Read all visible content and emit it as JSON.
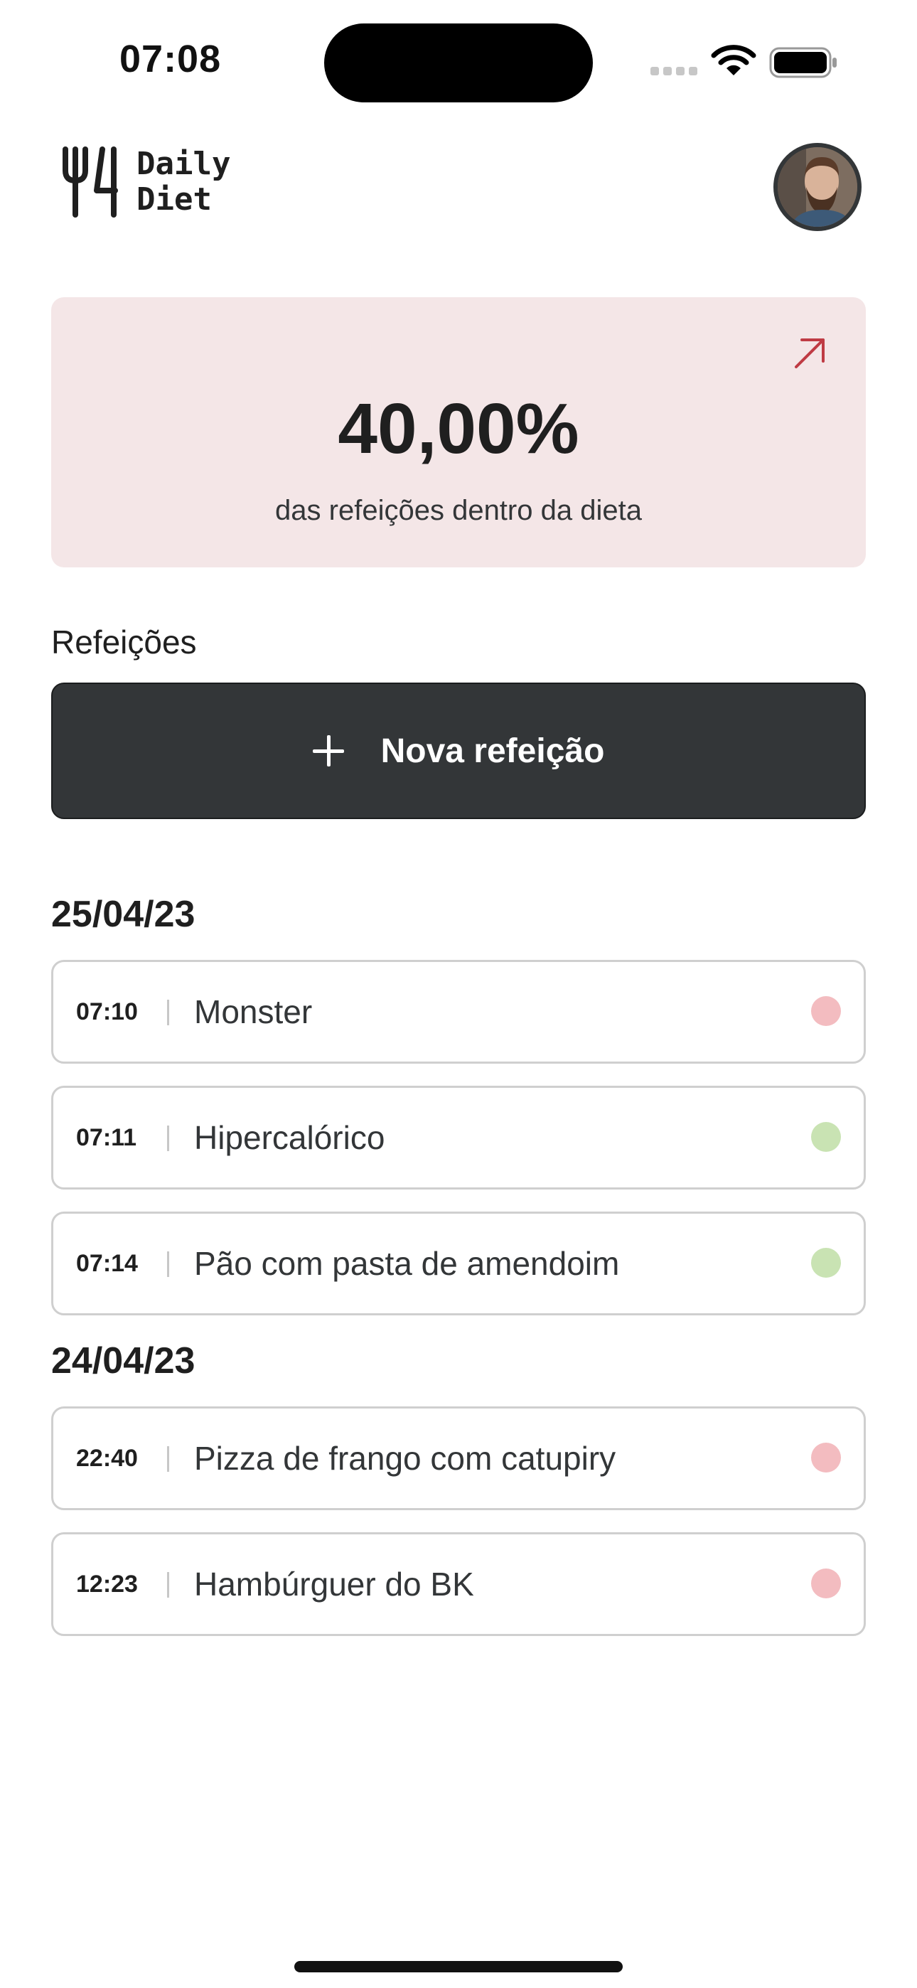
{
  "status_bar": {
    "time": "07:08"
  },
  "header": {
    "logo_line1": "Daily",
    "logo_line2": "Diet"
  },
  "stats": {
    "percentage": "40,00%",
    "label": "das refeições dentro da dieta"
  },
  "meals_section": {
    "title": "Refeições",
    "new_meal_label": "Nova refeição"
  },
  "colors": {
    "card_bg": "#f4e6e7",
    "accent_red": "#bf3b44",
    "button_dark": "#333638",
    "status_in_diet": "#c9e3b3",
    "status_out_diet": "#f3bcc0"
  },
  "days": [
    {
      "date": "25/04/23",
      "meals": [
        {
          "time": "07:10",
          "name": "Monster",
          "in_diet": false
        },
        {
          "time": "07:11",
          "name": "Hipercalórico",
          "in_diet": true
        },
        {
          "time": "07:14",
          "name": "Pão com pasta de amendoim",
          "in_diet": true
        }
      ]
    },
    {
      "date": "24/04/23",
      "meals": [
        {
          "time": "22:40",
          "name": "Pizza de frango com catupiry",
          "in_diet": false
        },
        {
          "time": "12:23",
          "name": "Hambúrguer do BK",
          "in_diet": false
        }
      ]
    }
  ]
}
